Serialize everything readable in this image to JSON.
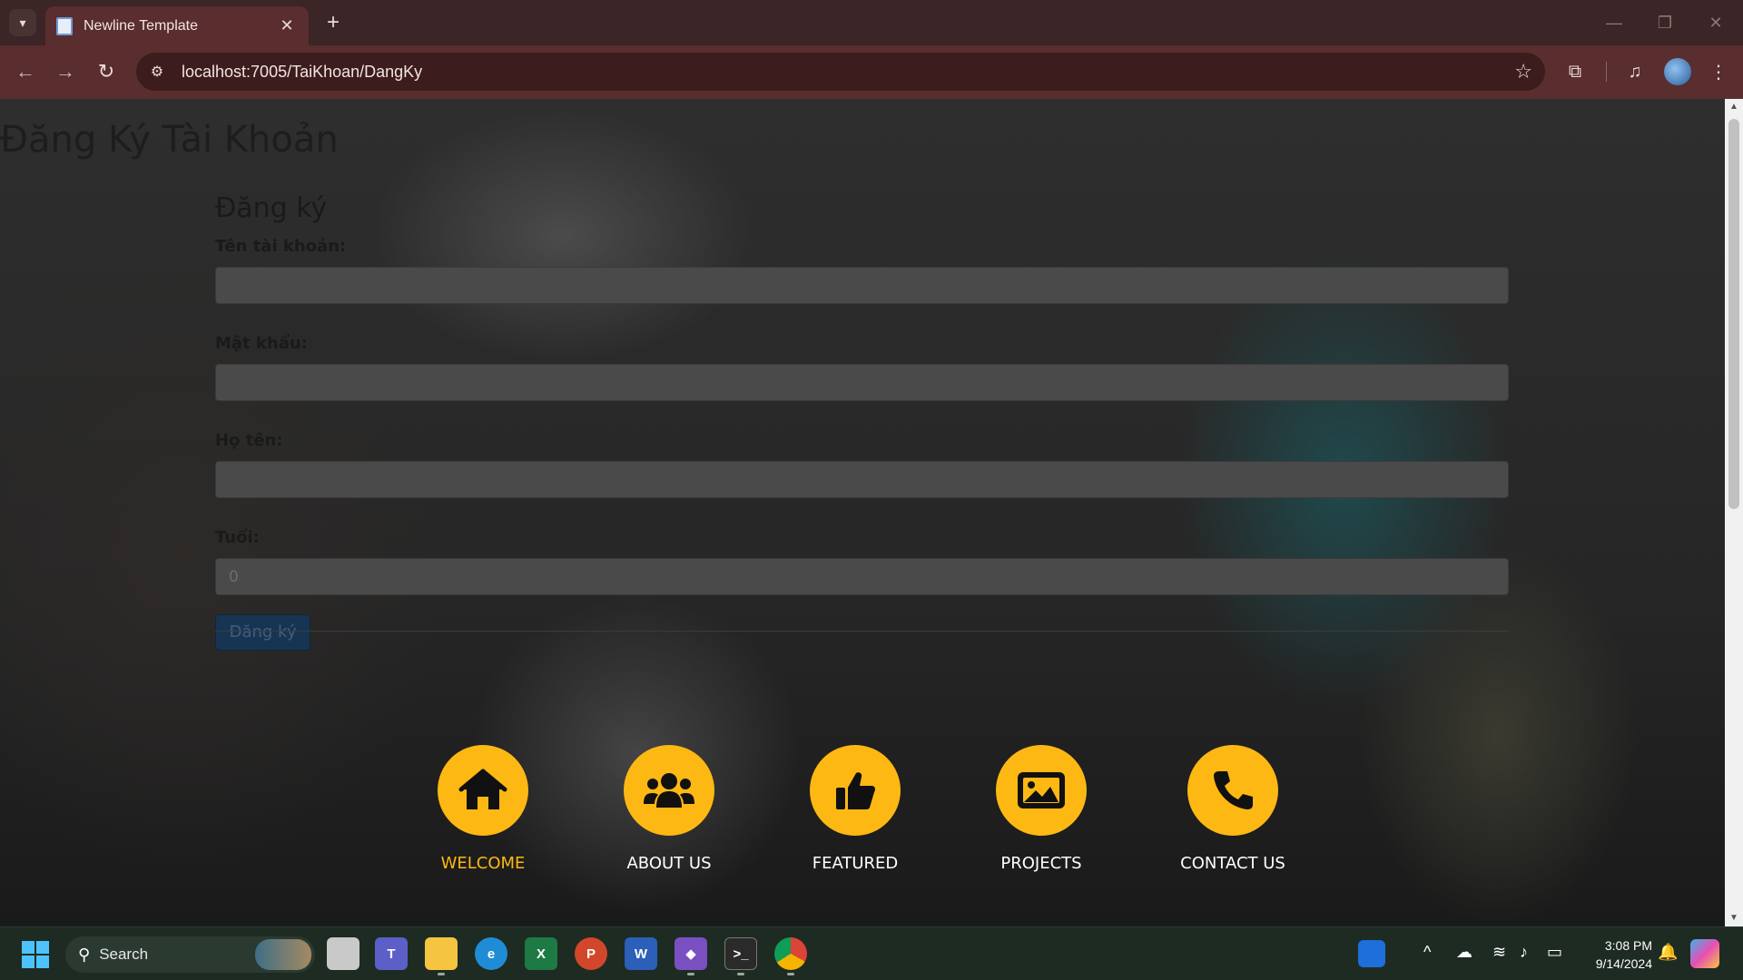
{
  "browser": {
    "tab_title": "Newline Template",
    "url": "localhost:7005/TaiKhoan/DangKy"
  },
  "page": {
    "heading": "Đăng Ký Tài Khoản",
    "form_title": "Đăng ký",
    "fields": [
      {
        "label": "Tên tài khoản:",
        "value": ""
      },
      {
        "label": "Mật khẩu:",
        "value": ""
      },
      {
        "label": "Họ tên:",
        "value": ""
      },
      {
        "label": "Tuổi:",
        "value": "0"
      }
    ],
    "submit_label": "Đăng ký"
  },
  "nav": {
    "items": [
      {
        "label": "WELCOME",
        "icon": "home-icon",
        "active": true
      },
      {
        "label": "ABOUT US",
        "icon": "users-icon",
        "active": false
      },
      {
        "label": "FEATURED",
        "icon": "thumbs-up-icon",
        "active": false
      },
      {
        "label": "PROJECTS",
        "icon": "image-icon",
        "active": false
      },
      {
        "label": "CONTACT US",
        "icon": "phone-icon",
        "active": false
      }
    ],
    "accent_color": "#fdb813"
  },
  "taskbar": {
    "search_label": "Search",
    "time": "3:08 PM",
    "date": "9/14/2024"
  }
}
